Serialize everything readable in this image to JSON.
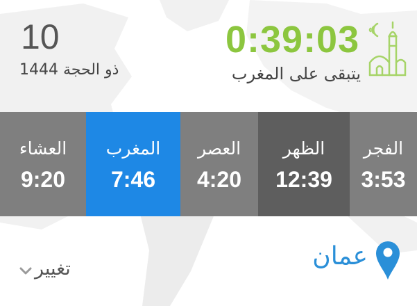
{
  "hijri": {
    "day": "10",
    "month_year": "ذو الحجة 1444"
  },
  "countdown": {
    "time": "0:39:03",
    "label": "يتبقى على المغرب",
    "color": "#8cc63f"
  },
  "prayers": [
    {
      "name": "العشاء",
      "time": "9:20",
      "color": "#7f7f7f"
    },
    {
      "name": "المغرب",
      "time": "7:46",
      "color": "#1e88e5"
    },
    {
      "name": "العصر",
      "time": "4:20",
      "color": "#7f7f7f"
    },
    {
      "name": "الظهر",
      "time": "12:39",
      "color": "#5e5e5e"
    },
    {
      "name": "الفجر",
      "time": "3:53",
      "color": "#7f7f7f"
    }
  ],
  "location": {
    "name": "عمان",
    "change_label": "تغيير",
    "color": "#2a8fd8"
  },
  "icons": {
    "mosque": "mosque-icon",
    "pin": "location-pin-icon",
    "chevron": "chevron-down-icon"
  }
}
